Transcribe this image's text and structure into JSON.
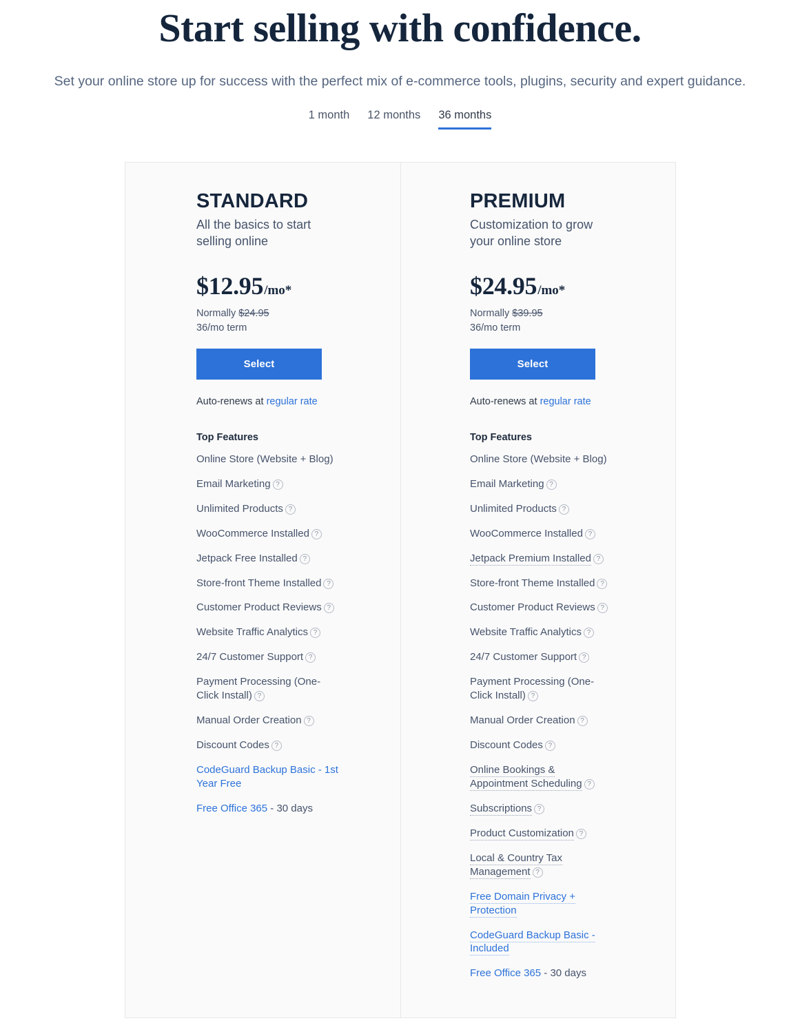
{
  "hero": {
    "title": "Start selling with confidence.",
    "subtitle": "Set your online store up for success with the perfect mix of e-commerce tools, plugins, security and expert guidance."
  },
  "term_tabs": {
    "options": [
      "1 month",
      "12 months",
      "36 months"
    ],
    "selected": "36 months"
  },
  "colors": {
    "accent": "#2d72d9",
    "heading": "#16263c",
    "body_text": "#46536b",
    "card_background": "#fafafa",
    "card_border": "#e7e7e7"
  },
  "icons": {
    "help": "?"
  },
  "plans": [
    {
      "name": "STANDARD",
      "tagline": "All the basics to start selling online",
      "price": "$12.95",
      "price_period": "/mo*",
      "normally_label": "Normally",
      "normally_price": "$24.95",
      "term_note": "36/mo term",
      "select_label": "Select",
      "renew_prefix": "Auto-renews at ",
      "renew_link": "regular rate",
      "features_title": "Top Features",
      "features": [
        {
          "text": "Online Store (Website + Blog)",
          "help": false,
          "dotted": false,
          "link": false
        },
        {
          "text": "Email Marketing",
          "help": true,
          "dotted": false,
          "link": false
        },
        {
          "text": "Unlimited Products",
          "help": true,
          "dotted": false,
          "link": false
        },
        {
          "text": "WooCommerce Installed",
          "help": true,
          "dotted": false,
          "link": false
        },
        {
          "text": "Jetpack Free Installed",
          "help": true,
          "dotted": false,
          "link": false
        },
        {
          "text": "Store-front Theme Installed",
          "help": true,
          "dotted": false,
          "link": false
        },
        {
          "text": "Customer Product Reviews",
          "help": true,
          "dotted": false,
          "link": false
        },
        {
          "text": "Website Traffic Analytics",
          "help": true,
          "dotted": false,
          "link": false
        },
        {
          "text": "24/7 Customer Support",
          "help": true,
          "dotted": false,
          "link": false
        },
        {
          "text": "Payment Processing (One-Click Install)",
          "help": true,
          "dotted": false,
          "link": false
        },
        {
          "text": "Manual Order Creation",
          "help": true,
          "dotted": false,
          "link": false
        },
        {
          "text": "Discount Codes",
          "help": true,
          "dotted": false,
          "link": false
        },
        {
          "text": "CodeGuard Backup Basic - 1st Year Free",
          "help": false,
          "dotted": false,
          "link": true
        },
        {
          "text": "Free Office 365",
          "suffix": " - 30 days",
          "help": false,
          "dotted": false,
          "link": true
        }
      ]
    },
    {
      "name": "PREMIUM",
      "tagline": "Customization to grow your online store",
      "price": "$24.95",
      "price_period": "/mo*",
      "normally_label": "Normally",
      "normally_price": "$39.95",
      "term_note": "36/mo term",
      "select_label": "Select",
      "renew_prefix": "Auto-renews at ",
      "renew_link": "regular rate",
      "features_title": "Top Features",
      "features": [
        {
          "text": "Online Store (Website + Blog)",
          "help": false,
          "dotted": false,
          "link": false
        },
        {
          "text": "Email Marketing",
          "help": true,
          "dotted": false,
          "link": false
        },
        {
          "text": "Unlimited Products",
          "help": true,
          "dotted": false,
          "link": false
        },
        {
          "text": "WooCommerce Installed",
          "help": true,
          "dotted": false,
          "link": false
        },
        {
          "text": "Jetpack Premium Installed",
          "help": true,
          "dotted": true,
          "link": false
        },
        {
          "text": "Store-front Theme Installed",
          "help": true,
          "dotted": false,
          "link": false
        },
        {
          "text": "Customer Product Reviews",
          "help": true,
          "dotted": false,
          "link": false
        },
        {
          "text": "Website Traffic Analytics",
          "help": true,
          "dotted": false,
          "link": false
        },
        {
          "text": "24/7 Customer Support",
          "help": true,
          "dotted": false,
          "link": false
        },
        {
          "text": "Payment Processing (One-Click Install)",
          "help": true,
          "dotted": false,
          "link": false
        },
        {
          "text": "Manual Order Creation",
          "help": true,
          "dotted": false,
          "link": false
        },
        {
          "text": "Discount Codes",
          "help": true,
          "dotted": false,
          "link": false
        },
        {
          "text": "Online Bookings & Appointment Scheduling",
          "help": true,
          "dotted": true,
          "link": false
        },
        {
          "text": "Subscriptions",
          "help": true,
          "dotted": true,
          "link": false
        },
        {
          "text": "Product Customization",
          "help": true,
          "dotted": true,
          "link": false
        },
        {
          "text": "Local & Country Tax Management",
          "help": true,
          "dotted": true,
          "link": false
        },
        {
          "text": "Free Domain Privacy + Protection",
          "help": false,
          "dotted": true,
          "link": true
        },
        {
          "text": "CodeGuard Backup Basic - Included",
          "help": false,
          "dotted": true,
          "link": true
        },
        {
          "text": "Free Office 365",
          "suffix": " - 30 days",
          "help": false,
          "dotted": false,
          "link": true
        }
      ]
    }
  ]
}
